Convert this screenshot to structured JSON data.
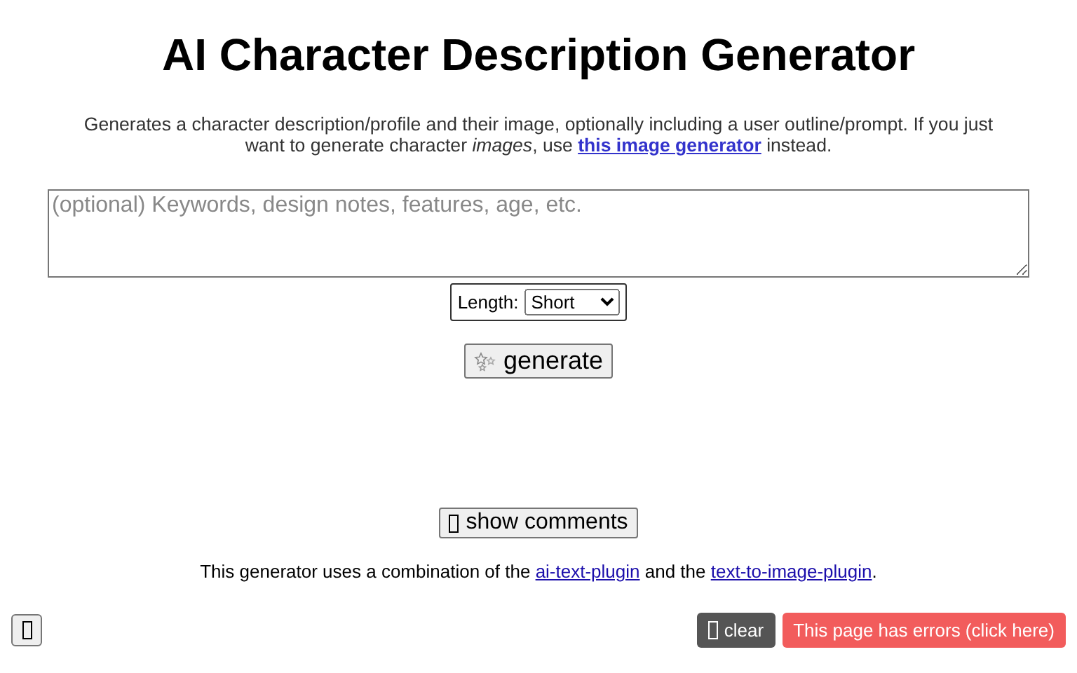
{
  "title": "AI Character Description Generator",
  "intro": {
    "before": "Generates a character description/profile and their image, optionally including a user outline/prompt. If you just want to generate character *images*, use ",
    "link": "this image generator",
    "after": " instead."
  },
  "prompt": {
    "placeholder": "(optional) Keywords, design notes, features, age, etc."
  },
  "length": {
    "label": "Length:",
    "value": "Short"
  },
  "generate_button": "generate",
  "comments_button": "show comments",
  "credits": {
    "before": "This generator uses a combination of the ",
    "link_1": "ai-text-plugin",
    "middle": " and the ",
    "link_2": "text-to-image-plugin",
    "after": "."
  },
  "clear_button": "clear",
  "error_button": "This page has errors (click here)"
}
